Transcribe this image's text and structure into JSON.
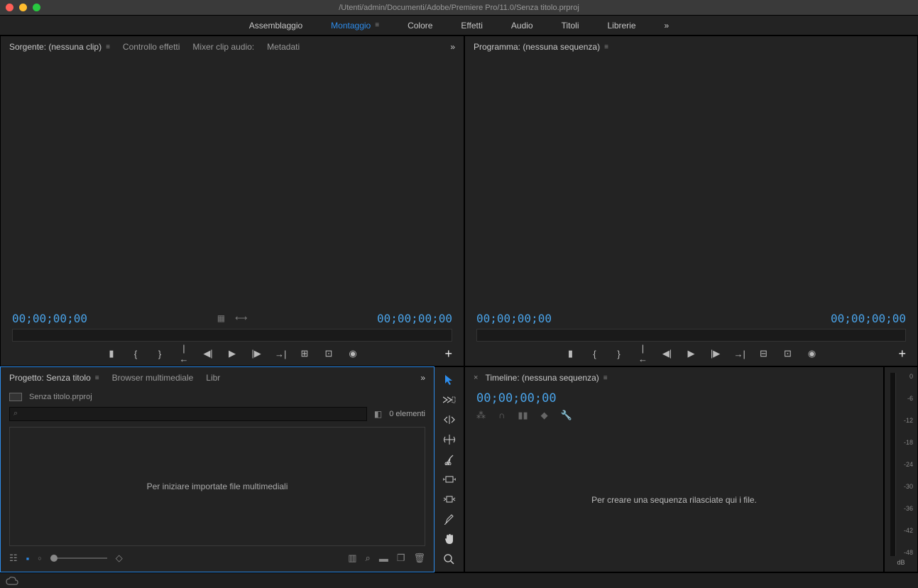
{
  "titlebar": {
    "path": "/Utenti/admin/Documenti/Adobe/Premiere Pro/11.0/Senza titolo.prproj"
  },
  "workspaces": {
    "items": [
      {
        "label": "Assemblaggio",
        "active": false
      },
      {
        "label": "Montaggio",
        "active": true
      },
      {
        "label": "Colore",
        "active": false
      },
      {
        "label": "Effetti",
        "active": false
      },
      {
        "label": "Audio",
        "active": false
      },
      {
        "label": "Titoli",
        "active": false
      },
      {
        "label": "Librerie",
        "active": false
      }
    ]
  },
  "source_panel": {
    "tabs": [
      {
        "label": "Sorgente: (nessuna clip)",
        "active": true
      },
      {
        "label": "Controllo effetti",
        "active": false
      },
      {
        "label": "Mixer clip audio:",
        "active": false
      },
      {
        "label": "Metadati",
        "active": false
      }
    ],
    "tc_in": "00;00;00;00",
    "tc_out": "00;00;00;00"
  },
  "program_panel": {
    "tab_label": "Programma: (nessuna sequenza)",
    "tc_in": "00;00;00;00",
    "tc_out": "00;00;00;00"
  },
  "project_panel": {
    "tabs": [
      {
        "label": "Progetto: Senza titolo",
        "active": true
      },
      {
        "label": "Browser multimediale",
        "active": false
      },
      {
        "label": "Libr",
        "active": false
      }
    ],
    "file_name": "Senza titolo.prproj",
    "search_placeholder": "",
    "item_count": "0 elementi",
    "drop_hint": "Per iniziare importate file multimediali"
  },
  "timeline_panel": {
    "tab_label": "Timeline: (nessuna sequenza)",
    "tc": "00;00;00;00",
    "drop_hint": "Per creare una sequenza rilasciate qui i file."
  },
  "audio_meter": {
    "ticks": [
      "0",
      "-6",
      "-12",
      "-18",
      "-24",
      "-30",
      "-36",
      "-42",
      "-48"
    ],
    "label": "dB"
  }
}
